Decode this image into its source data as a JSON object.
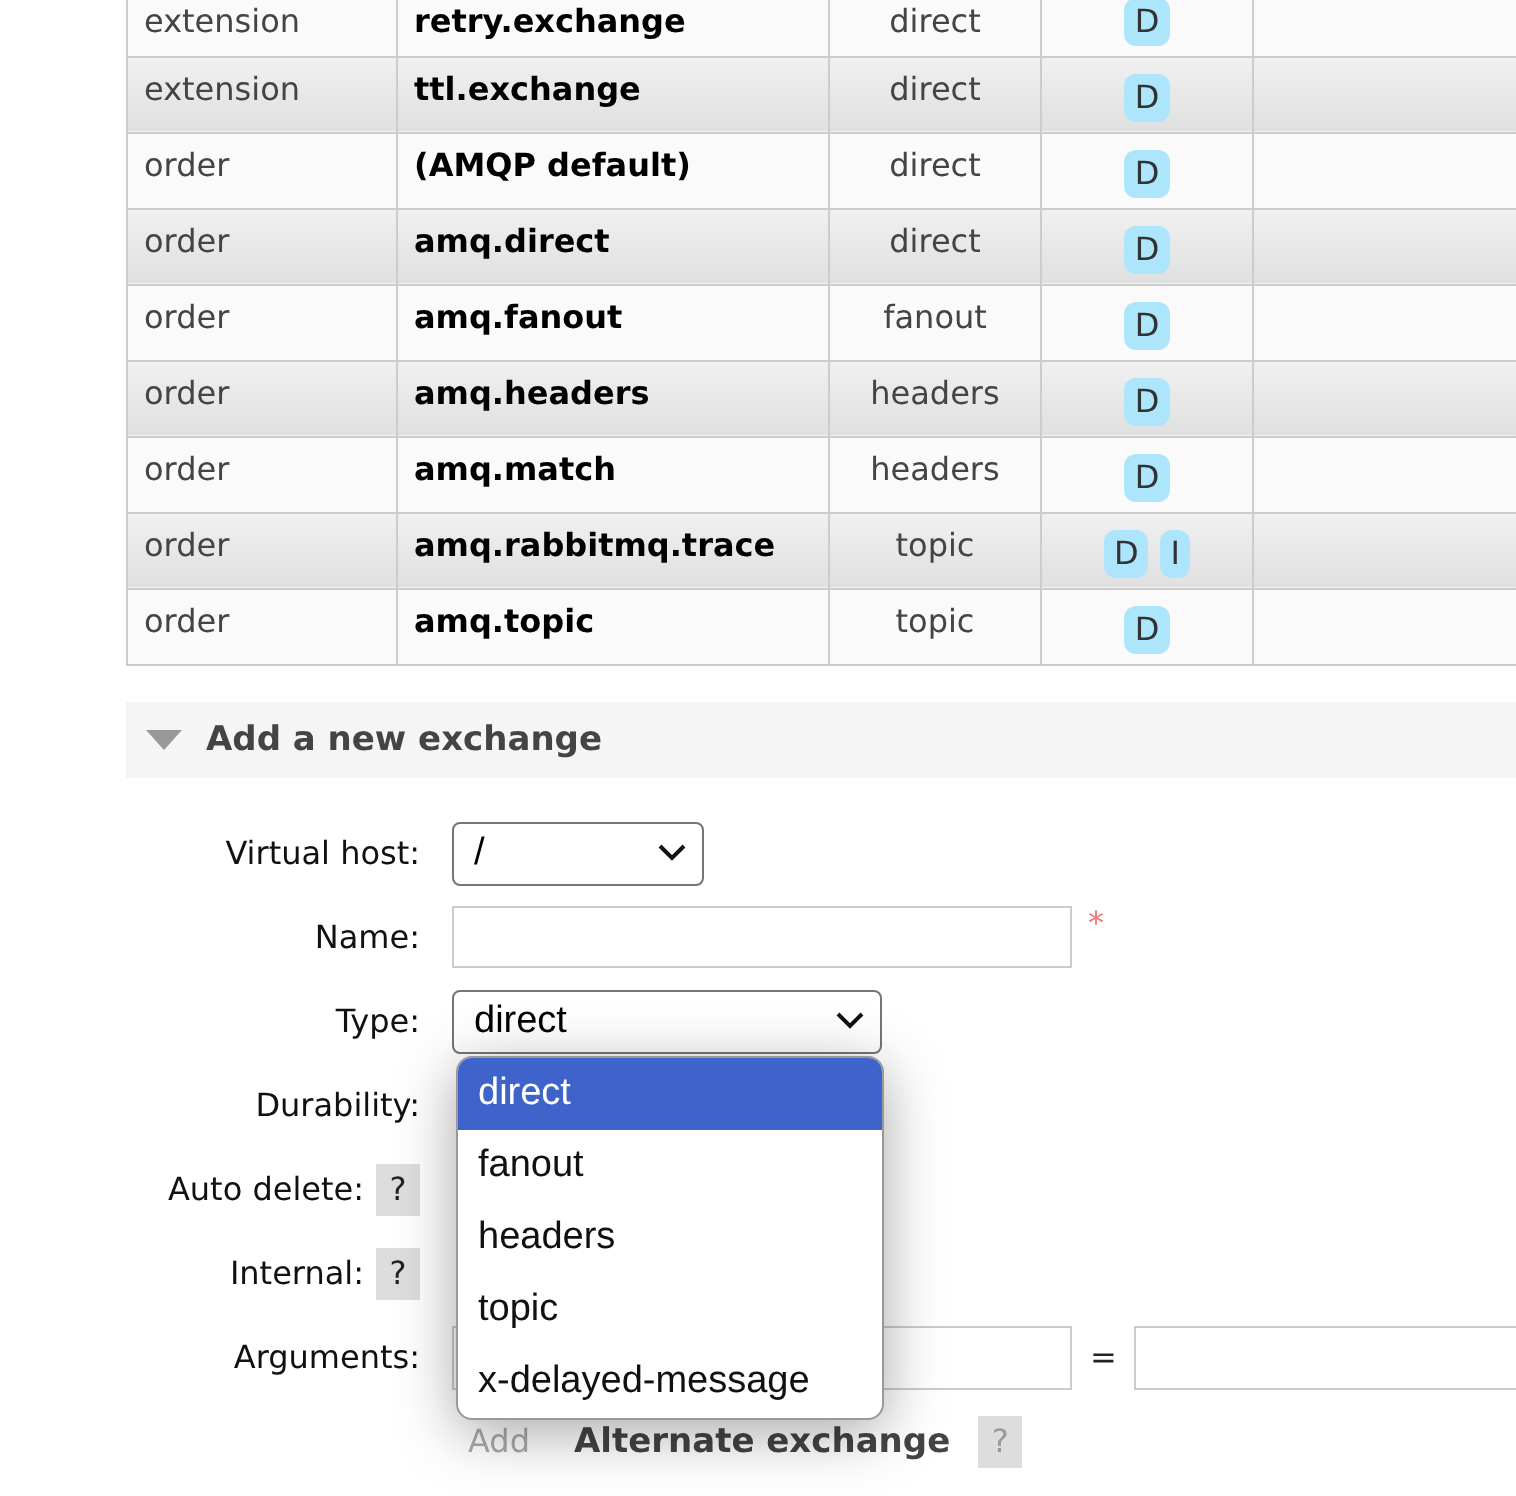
{
  "table": {
    "rows": [
      {
        "vhost": "extension",
        "name": "retry.exchange",
        "type": "direct",
        "features": [
          "D"
        ]
      },
      {
        "vhost": "extension",
        "name": "ttl.exchange",
        "type": "direct",
        "features": [
          "D"
        ]
      },
      {
        "vhost": "order",
        "name": "(AMQP default)",
        "type": "direct",
        "features": [
          "D"
        ]
      },
      {
        "vhost": "order",
        "name": "amq.direct",
        "type": "direct",
        "features": [
          "D"
        ]
      },
      {
        "vhost": "order",
        "name": "amq.fanout",
        "type": "fanout",
        "features": [
          "D"
        ]
      },
      {
        "vhost": "order",
        "name": "amq.headers",
        "type": "headers",
        "features": [
          "D"
        ]
      },
      {
        "vhost": "order",
        "name": "amq.match",
        "type": "headers",
        "features": [
          "D"
        ]
      },
      {
        "vhost": "order",
        "name": "amq.rabbitmq.trace",
        "type": "topic",
        "features": [
          "D",
          "I"
        ]
      },
      {
        "vhost": "order",
        "name": "amq.topic",
        "type": "topic",
        "features": [
          "D"
        ]
      }
    ]
  },
  "section": {
    "title": "Add a new exchange",
    "expanded": true
  },
  "form": {
    "fields": [
      {
        "label": "Virtual host:",
        "kind": "select",
        "value": "/"
      },
      {
        "label": "Name:",
        "kind": "text",
        "required_mark": "*"
      },
      {
        "label": "Type:",
        "kind": "select-open",
        "value": "direct"
      },
      {
        "label": "Durability:",
        "kind": "hidden"
      },
      {
        "label": "Auto delete:",
        "kind": "hidden",
        "help": "?"
      },
      {
        "label": "Internal:",
        "kind": "hidden",
        "help": "?"
      },
      {
        "label": "Arguments:",
        "kind": "pair",
        "separator": "="
      }
    ],
    "add_link": "Add",
    "alternate": {
      "label": "Alternate exchange",
      "help": "?"
    }
  },
  "dropdown": {
    "options": [
      {
        "label": "direct",
        "selected": true
      },
      {
        "label": "fanout",
        "selected": false
      },
      {
        "label": "headers",
        "selected": false
      },
      {
        "label": "topic",
        "selected": false
      },
      {
        "label": "x-delayed-message",
        "selected": false
      }
    ]
  }
}
